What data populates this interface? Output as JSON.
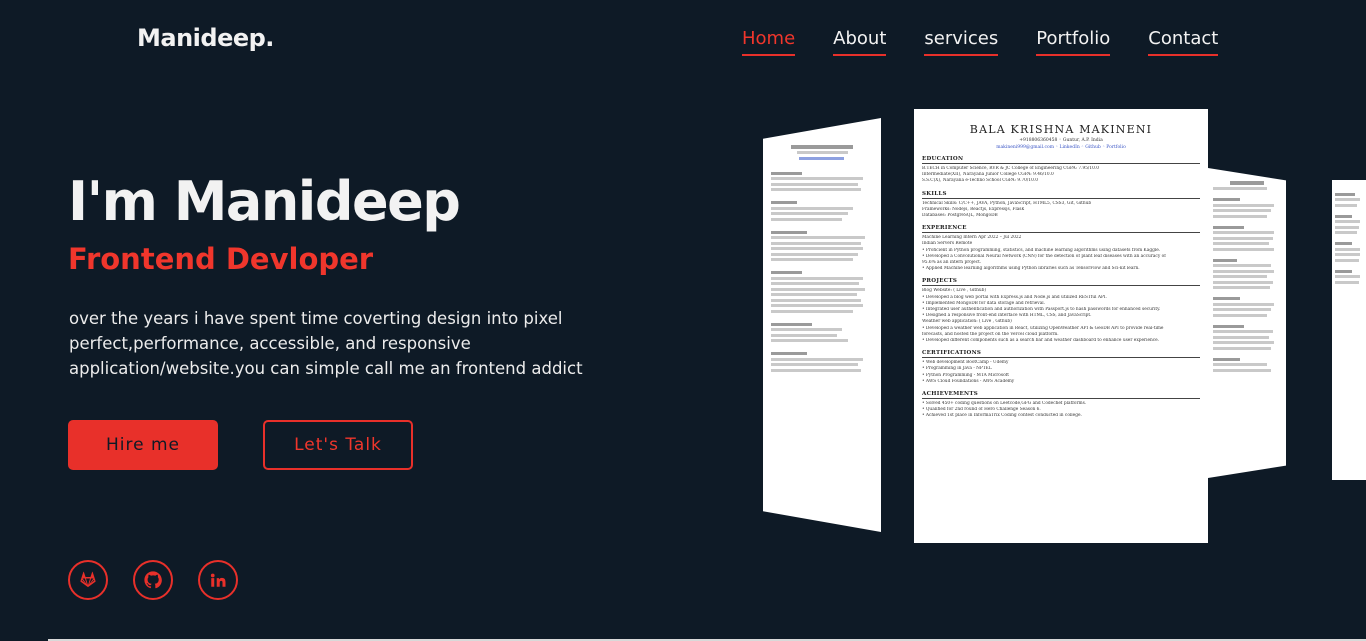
{
  "brand": {
    "logo": "Manideep."
  },
  "nav": [
    {
      "label": "Home",
      "active": true
    },
    {
      "label": "About",
      "active": false
    },
    {
      "label": "services",
      "active": false
    },
    {
      "label": "Portfolio",
      "active": false
    },
    {
      "label": "Contact",
      "active": false
    }
  ],
  "hero": {
    "title": "I'm Manideep",
    "subtitle": "Frontend Devloper",
    "description": "over the years i have spent time coverting design into pixel perfect,performance, accessible, and responsive application/website.you can simple call me an frontend addict",
    "hire_label": "Hire me",
    "talk_label": "Let's Talk"
  },
  "social": [
    {
      "icon": "gitlab-icon"
    },
    {
      "icon": "github-icon"
    },
    {
      "icon": "linkedin-icon"
    }
  ],
  "resume": {
    "name": "BALA KRISHNA MAKINENI",
    "contact": "+918806360458 ◦ Guntur, A.P. India",
    "links": "makineni999@gmail.com ◦ LinkedIn ◦ Github ◦ Portfolio",
    "sections": [
      {
        "heading": "EDUCATION",
        "lines": [
          "B.TECH in Computer Science, RVR & JC College of Engineering   CGPA: 7.95/10.0",
          "Intermediate(XII), Narayana Junior College   CGPA: 9.46/10.0",
          "S.S.C(X), Narayana e-Techno School   CGPA: 9.70/10.0"
        ]
      },
      {
        "heading": "SKILLS",
        "lines": [
          "Technical Skills:   C/C++, JAVA, Python, JavaScript, HTML5, CSS3, Git, Github",
          "Frameworks:   Nodejs, Reactjs, Expressjs, Flask",
          "Databases:   PostgreSQL, MongoDB"
        ]
      },
      {
        "heading": "EXPERIENCE",
        "lines": [
          "Machine Learning Intern                                   Apr 2022 – Jul 2022",
          "Indian Servers                                                     Remote",
          "• Proficient in Python programming, statistics, and machine learning algorithms using datasets from Kaggle.",
          "• Developed a Convolutional Neural Network (CNN) for the detection of plant leaf diseases with an accuracy of",
          "   95.6% as an intern project.",
          "• Applied Machine learning algorithms using Python libraries such as TensorFlow and Sci-kit learn."
        ]
      },
      {
        "heading": "PROJECTS",
        "lines": [
          "Blog Website: ( Live , Github)",
          "• Developed a blog web portal with Express.js and Node.js and utilized RESTful API.",
          "• Implemented MongoDB for data storage and retrieval.",
          "• Integrated user authentication and authorization with Passport.js to hash passwords for enhanced security.",
          "• Designed a responsive front-end interface with HTML, CSS, and JavaScript.",
          "Weather web application: ( Live , Github)",
          "• Developed a weather web application in React, utilizing OpenWeather API & GeoDB API to provide real-time",
          "   forecasts, and hosted the project on the Vercel cloud platform.",
          "• Developed different components such as a search bar and weather dashboard to enhance user experience."
        ]
      },
      {
        "heading": "CERTIFICATIONS",
        "lines": [
          "• Web development BootCamp - Udemy",
          "• Programming in Java - NPTEL",
          "• Python Programming - MTA Microsoft",
          "• AWS Cloud Foundations - AWS Academy"
        ]
      },
      {
        "heading": "ACHIEVEMENTS",
        "lines": [
          "• Solved 450+ coding questions on Leetcode,GFG and Codechef platforms.",
          "• Qualified for 2nd round of Hero Challenge Season 6.",
          "• Achieved 1st place in InformaTrix Coding contest conducted in college."
        ]
      }
    ]
  },
  "colors": {
    "background": "#0e1a26",
    "accent": "#e8302a",
    "text": "#f2f2f2"
  }
}
